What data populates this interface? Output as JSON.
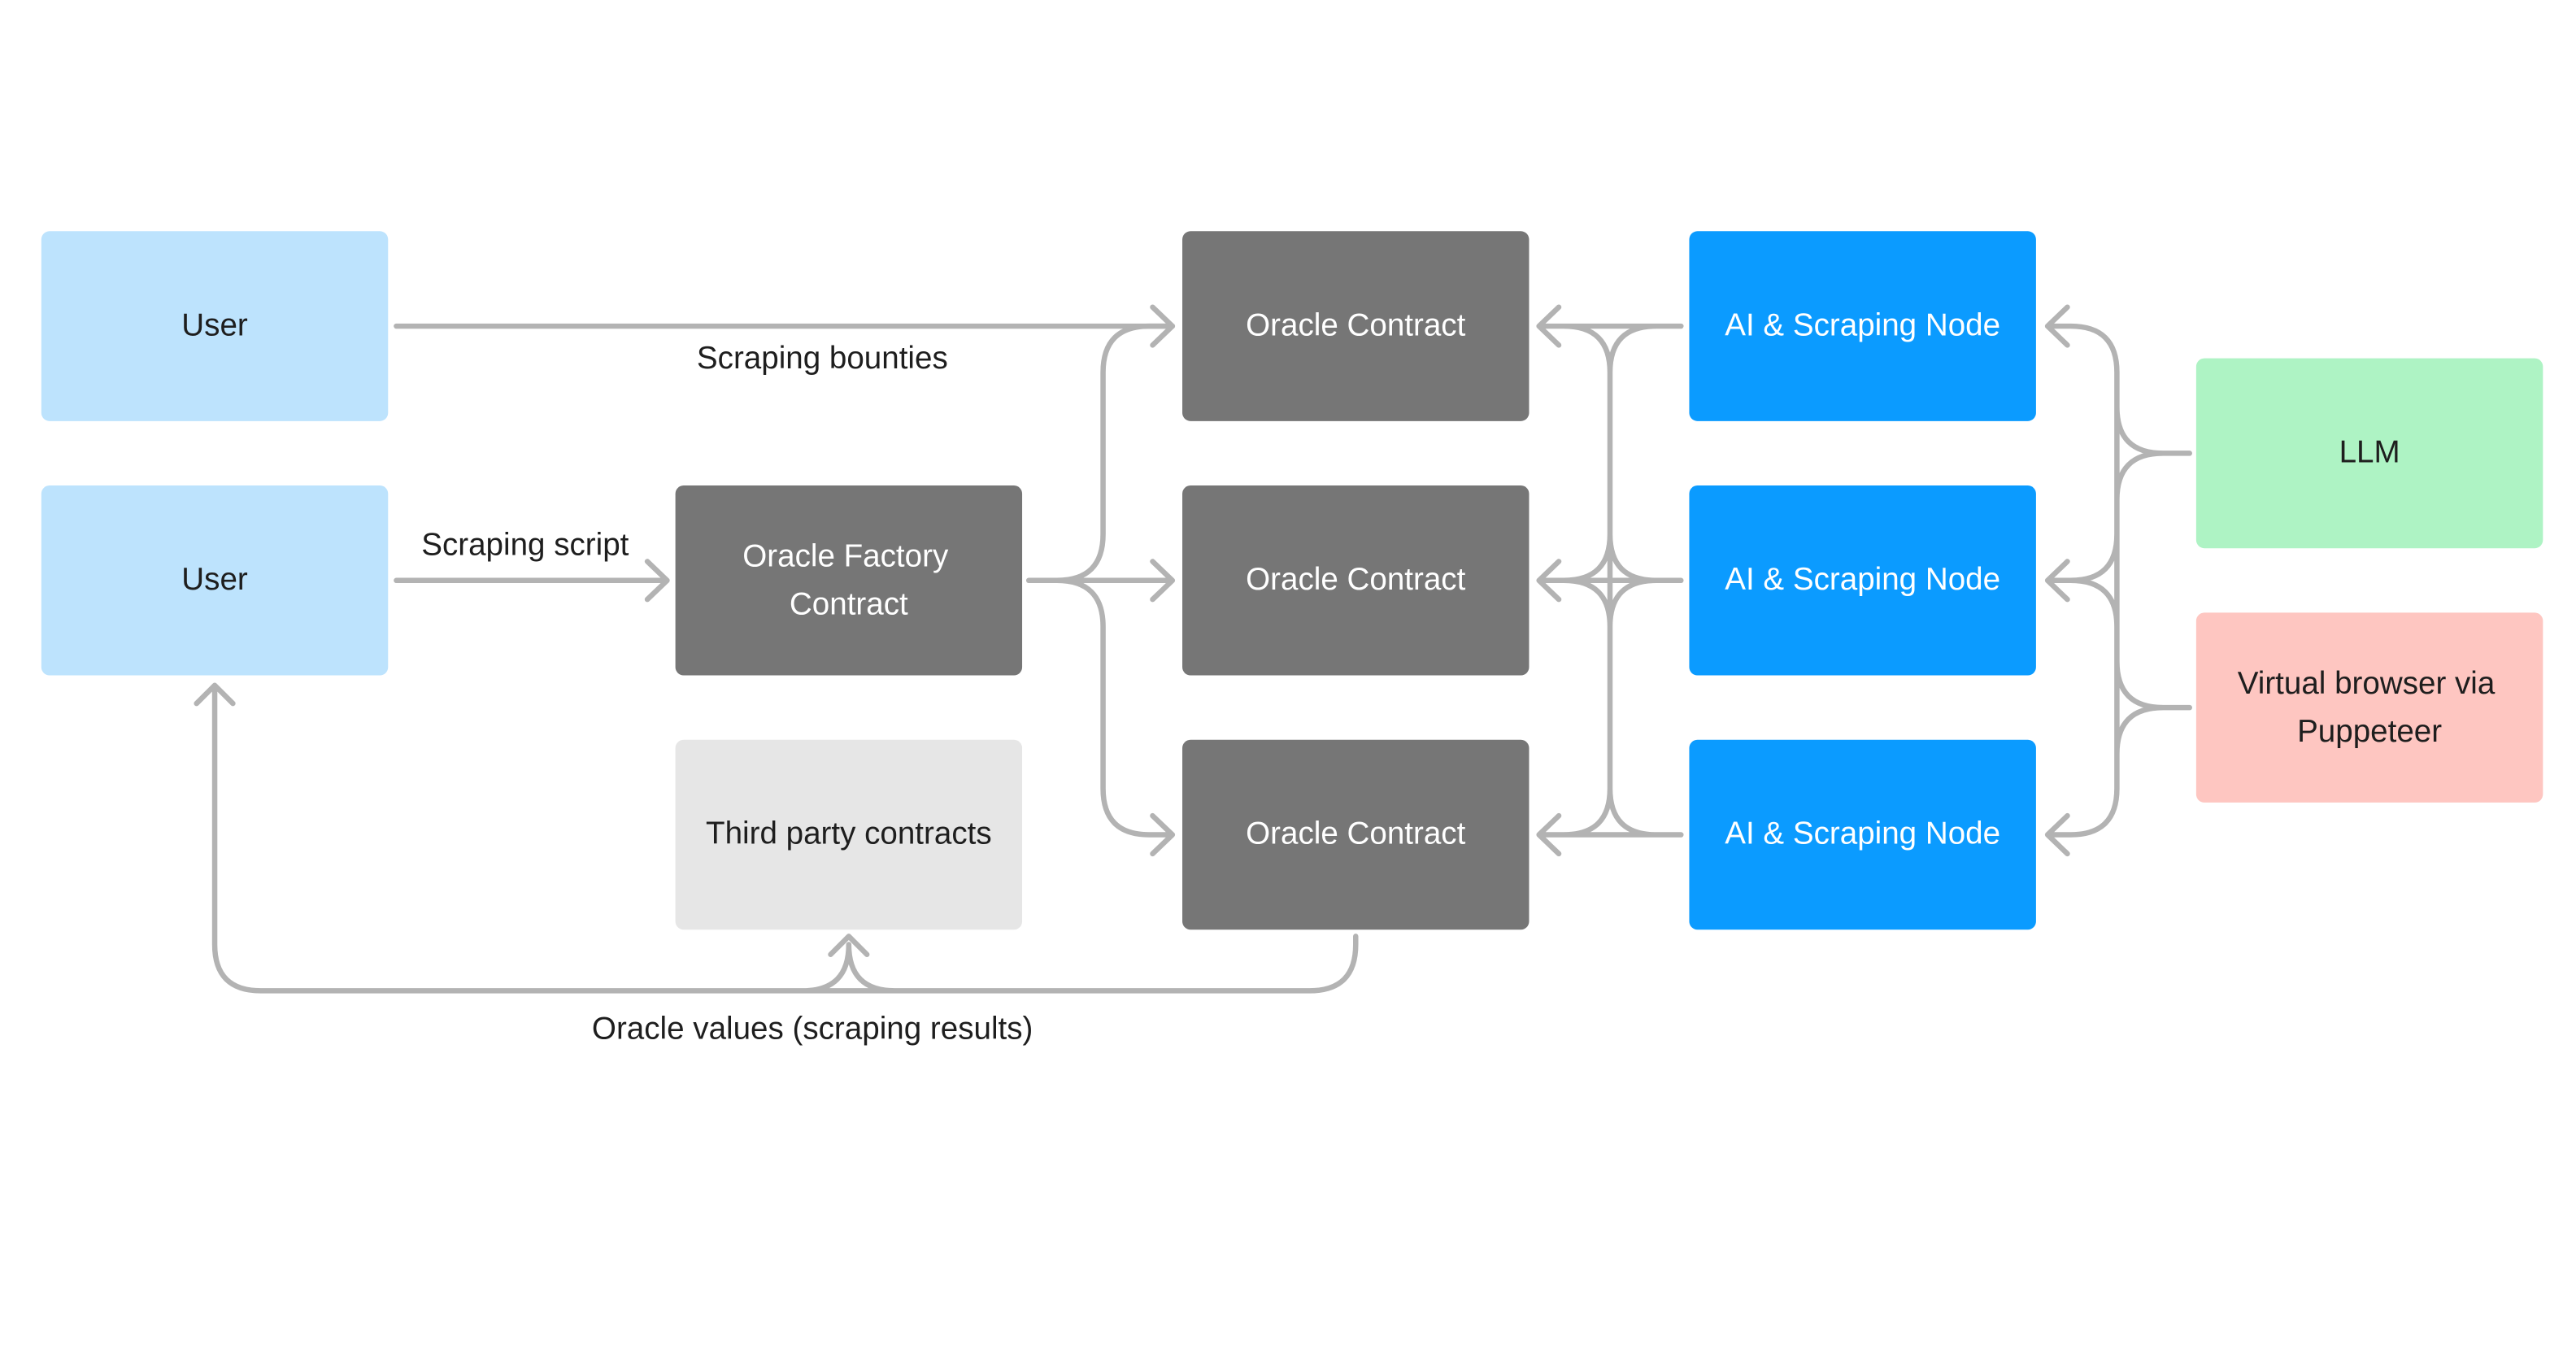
{
  "colors": {
    "user": "#bde3fd",
    "contract": "#767676",
    "third_party": "#e6e6e6",
    "node": "#0b9bff",
    "llm": "#aef3c4",
    "browser": "#fec6c1",
    "connector": "#b3b3b3"
  },
  "nodes": {
    "user_top": "User",
    "user_bottom": "User",
    "factory": [
      "Oracle Factory",
      "Contract"
    ],
    "third_party": "Third party contracts",
    "oracle_contracts": [
      "Oracle Contract",
      "Oracle Contract",
      "Oracle Contract"
    ],
    "ai_nodes": [
      "AI & Scraping Node",
      "AI & Scraping Node",
      "AI & Scraping Node"
    ],
    "llm": "LLM",
    "browser": [
      "Virtual browser via",
      "Puppeteer"
    ]
  },
  "edge_labels": {
    "bounties": "Scraping bounties",
    "script": "Scraping script",
    "results": "Oracle values (scraping results)"
  }
}
